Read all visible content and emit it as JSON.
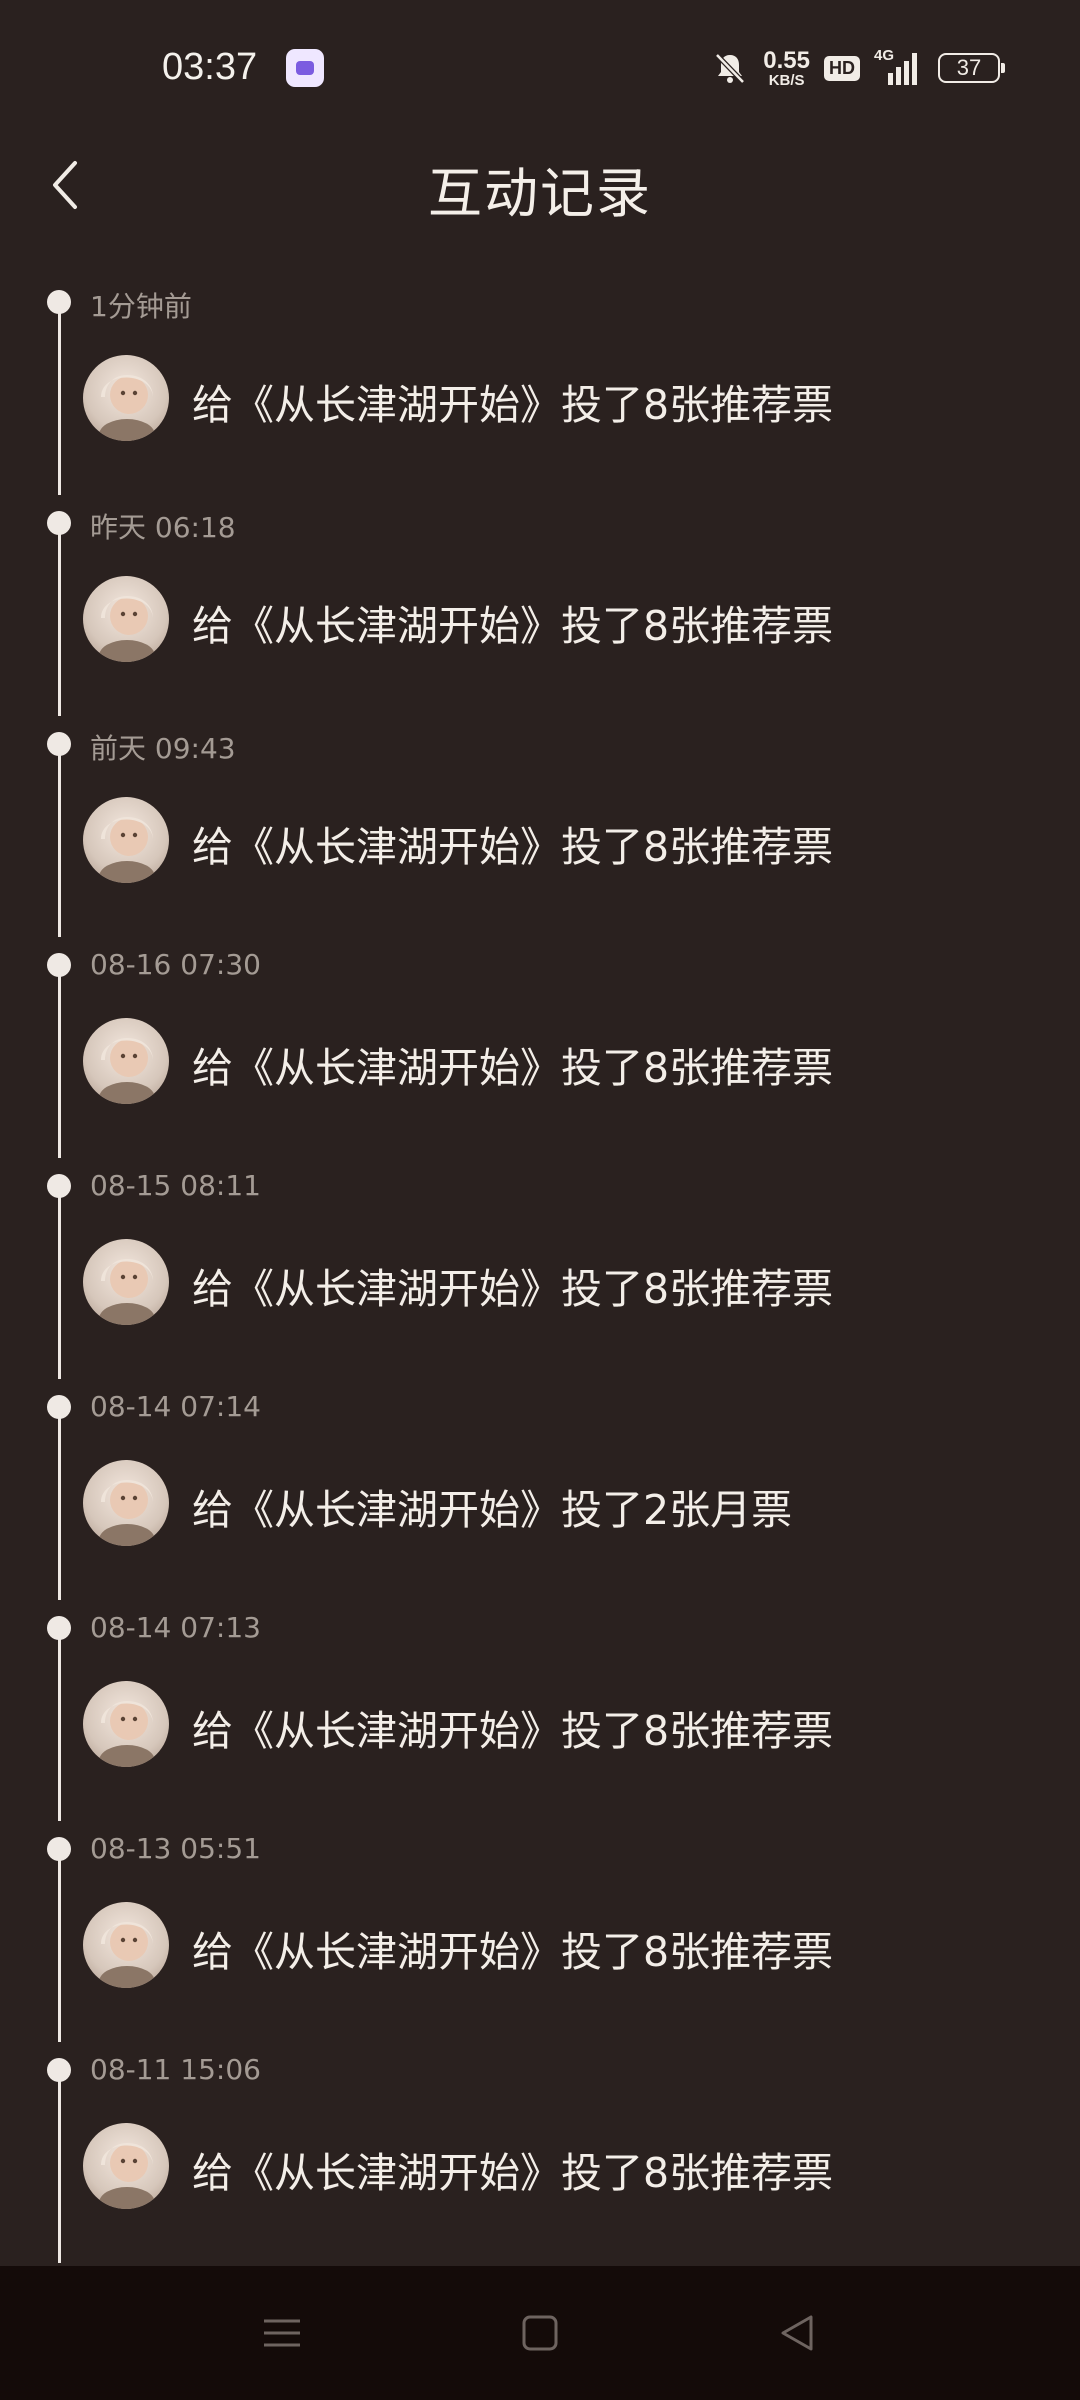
{
  "status_bar": {
    "time": "03:37",
    "speed_value": "0.55",
    "speed_unit": "KB/S",
    "hd": "HD",
    "network": "4G",
    "battery": "37",
    "icons": [
      "app-notification-icon",
      "mute-bell-icon",
      "signal-icon",
      "battery-icon"
    ]
  },
  "header": {
    "title": "互动记录",
    "back_icon": "chevron-left-icon"
  },
  "timeline": [
    {
      "time": "1分钟前",
      "text": "给《从长津湖开始》投了8张推荐票"
    },
    {
      "time": "昨天 06:18",
      "text": "给《从长津湖开始》投了8张推荐票"
    },
    {
      "time": "前天 09:43",
      "text": "给《从长津湖开始》投了8张推荐票"
    },
    {
      "time": "08-16 07:30",
      "text": "给《从长津湖开始》投了8张推荐票"
    },
    {
      "time": "08-15 08:11",
      "text": "给《从长津湖开始》投了8张推荐票"
    },
    {
      "time": "08-14 07:14",
      "text": "给《从长津湖开始》投了2张月票"
    },
    {
      "time": "08-14 07:13",
      "text": "给《从长津湖开始》投了8张推荐票"
    },
    {
      "time": "08-13 05:51",
      "text": "给《从长津湖开始》投了8张推荐票"
    },
    {
      "time": "08-11 15:06",
      "text": "给《从长津湖开始》投了8张推荐票"
    }
  ],
  "nav_bar": {
    "icons": [
      "menu-icon",
      "home-square-icon",
      "back-triangle-icon"
    ]
  },
  "colors": {
    "background": "#2a211f",
    "nav_background": "#140b09",
    "timeline_line": "#efe9e4",
    "time_text": "#a49b94",
    "main_text": "#f3eee8"
  }
}
